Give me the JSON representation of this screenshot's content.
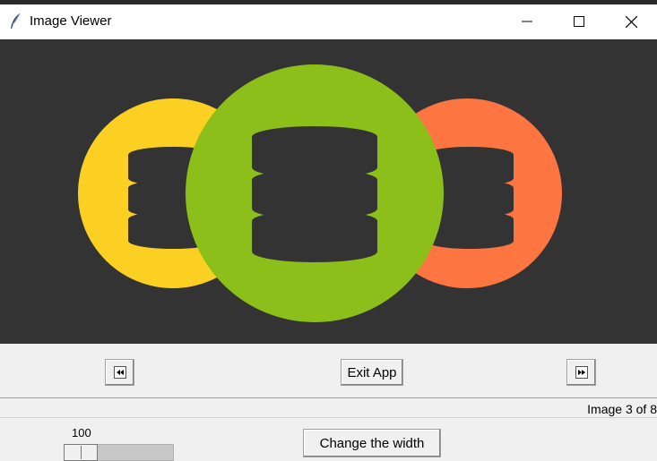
{
  "window": {
    "title": "Image Viewer",
    "icon": "feather-icon",
    "controls": [
      "minimize-icon",
      "maximize-icon",
      "close-icon"
    ]
  },
  "image": {
    "description_icons": [
      "database-icon",
      "database-icon",
      "database-icon"
    ],
    "colors": {
      "background": "#333333",
      "left_circle": "#fcd022",
      "center_circle": "#8dbf1a",
      "right_circle": "#fd7540",
      "stack": "#333333"
    }
  },
  "buttons": {
    "back_icon": "rewind-icon",
    "exit_label": "Exit App",
    "forward_icon": "fast-forward-icon",
    "change_width_label": "Change the width"
  },
  "status": {
    "text": "Image 3 of 8"
  },
  "scale": {
    "value": "100",
    "level": 0.0
  }
}
